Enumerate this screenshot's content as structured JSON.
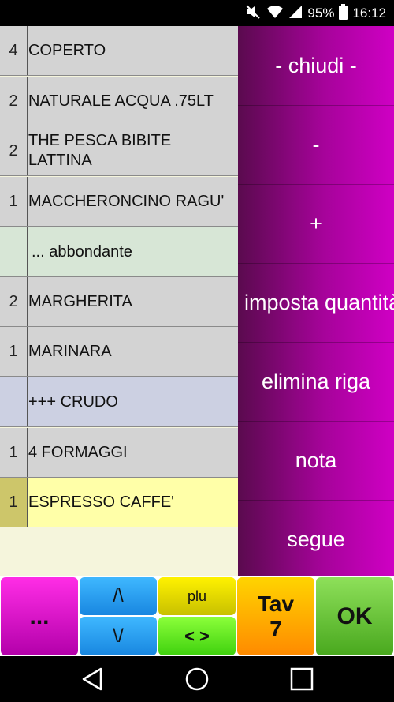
{
  "status_bar": {
    "battery_percent": "95%",
    "time": "16:12",
    "icons": [
      "mute-icon",
      "wifi-icon",
      "signal-icon",
      "battery-icon"
    ]
  },
  "order": {
    "rows": [
      {
        "qty": "4",
        "desc": "COPERTO",
        "style": "grey"
      },
      {
        "qty": "2",
        "desc": "NATURALE ACQUA .75LT",
        "style": "grey"
      },
      {
        "qty": "2",
        "desc": "THE PESCA BIBITE LATTINA",
        "style": "grey"
      },
      {
        "qty": "1",
        "desc": "MACCHERONCINO RAGU'",
        "style": "grey"
      },
      {
        "qty": "",
        "desc": "... abbondante",
        "style": "green"
      },
      {
        "qty": "2",
        "desc": "MARGHERITA",
        "style": "grey"
      },
      {
        "qty": "1",
        "desc": "MARINARA",
        "style": "grey"
      },
      {
        "qty": "",
        "desc": "+++ CRUDO",
        "style": "blue"
      },
      {
        "qty": "1",
        "desc": "4 FORMAGGI",
        "style": "grey"
      },
      {
        "qty": "1",
        "desc": "ESPRESSO CAFFE'",
        "style": "yellow"
      }
    ]
  },
  "side_menu": {
    "chiudi": "- chiudi -",
    "minus": "-",
    "plus": "+",
    "imposta": "imposta quantità",
    "elimina": "elimina riga",
    "nota": "nota",
    "segue": "segue"
  },
  "bottom_bar": {
    "more": "...",
    "up": "/\\",
    "down": "\\/",
    "plu": "plu",
    "arrows": "< >",
    "tav_label": "Tav",
    "tav_number": "7",
    "ok": "OK"
  },
  "colors": {
    "side_gradient": [
      "#5a0a4e",
      "#cf00c4"
    ],
    "row_grey": "#d3d3d3",
    "row_green": "#d7e6d6",
    "row_blue": "#ccd0e2",
    "row_yellow": "#ffffa8"
  }
}
